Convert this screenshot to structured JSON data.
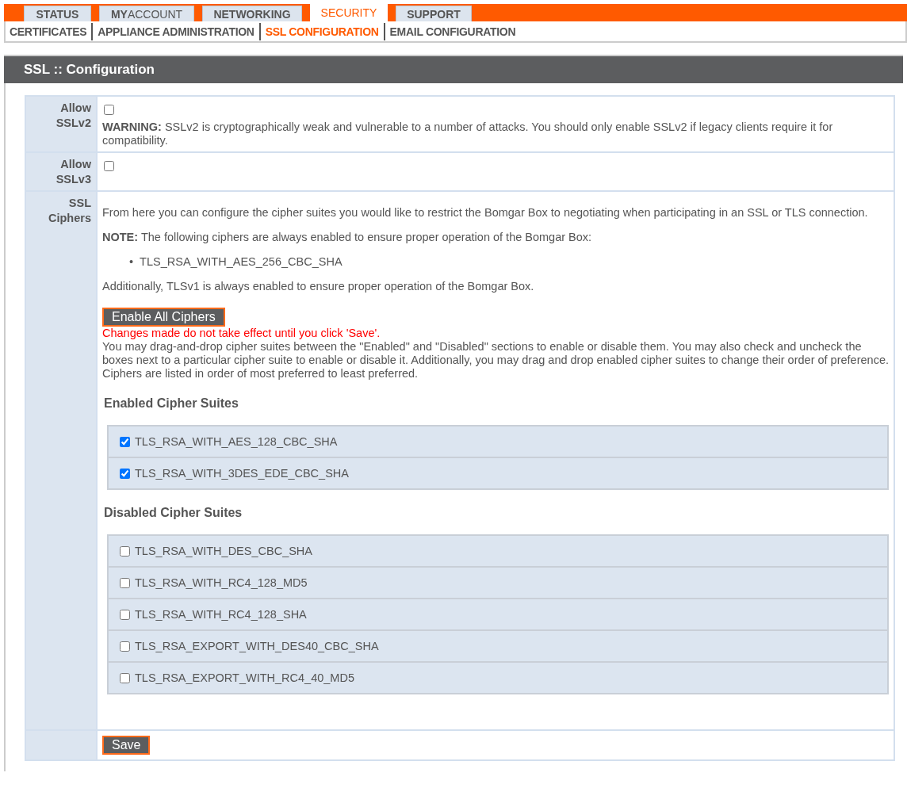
{
  "tabs": [
    {
      "label": "STATUS",
      "selected": false
    },
    {
      "label": "**MY**ACCOUNT",
      "selected": false
    },
    {
      "label": "NETWORKING",
      "selected": false
    },
    {
      "label": "SECURITY",
      "selected": true
    },
    {
      "label": "SUPPORT",
      "selected": false
    }
  ],
  "subnav": [
    {
      "label": "CERTIFICATES",
      "selected": false
    },
    {
      "label": "APPLIANCE ADMINISTRATION",
      "selected": false
    },
    {
      "label": "SSL CONFIGURATION",
      "selected": true
    },
    {
      "label": "EMAIL CONFIGURATION",
      "selected": false
    }
  ],
  "panel": {
    "title": "SSL :: Configuration",
    "rows": [
      {
        "kind": "checkbox",
        "label": "Allow SSLv2",
        "checked": false,
        "warning": "**WARNING:** SSLv2 is cryptographically weak and vulnerable to a number of attacks. You should only enable SSLv2 if legacy clients require it for compatibility."
      },
      {
        "kind": "checkbox",
        "label": "Allow SSLv3",
        "checked": false
      },
      {
        "kind": "ciphers",
        "label": "SSL Ciphers",
        "intro": "From here you can configure the cipher suites you would like to restrict the Bomgar Box to negotiating when participating in an SSL or TLS connection.",
        "note": "**NOTE:** The following ciphers are always enabled to ensure proper operation of the Bomgar Box:",
        "always_enabled": [
          {
            "marker": "•",
            "name": "TLS_RSA_WITH_AES_256_CBC_SHA"
          }
        ],
        "additional": "Additionally, TLSv1 is always enabled to ensure proper operation of the Bomgar Box.",
        "button": "Enable All Ciphers",
        "alert": "Changes made do not take effect until you click 'Save'.",
        "help": "You may drag-and-drop cipher suites between the \"Enabled\" and \"Disabled\" sections to enable or disable them. You may also check and uncheck the boxes next to a particular cipher suite to enable or disable it. Additionally, you may drag and drop enabled cipher suites to change their order of preference. Ciphers are listed in order of most preferred to least preferred.",
        "groups": [
          {
            "title": "Enabled Cipher Suites",
            "suites": [
              {
                "name": "TLS_RSA_WITH_AES_128_CBC_SHA",
                "checked": true
              },
              {
                "name": "TLS_RSA_WITH_3DES_EDE_CBC_SHA",
                "checked": true
              }
            ]
          },
          {
            "title": "Disabled Cipher Suites",
            "suites": [
              {
                "name": "TLS_RSA_WITH_DES_CBC_SHA",
                "checked": false
              },
              {
                "name": "TLS_RSA_WITH_RC4_128_MD5",
                "checked": false
              },
              {
                "name": "TLS_RSA_WITH_RC4_128_SHA",
                "checked": false
              },
              {
                "name": "TLS_RSA_EXPORT_WITH_DES40_CBC_SHA",
                "checked": false
              },
              {
                "name": "TLS_RSA_EXPORT_WITH_RC4_40_MD5",
                "checked": false
              }
            ]
          }
        ]
      },
      {
        "kind": "save",
        "button": "Save"
      }
    ]
  }
}
